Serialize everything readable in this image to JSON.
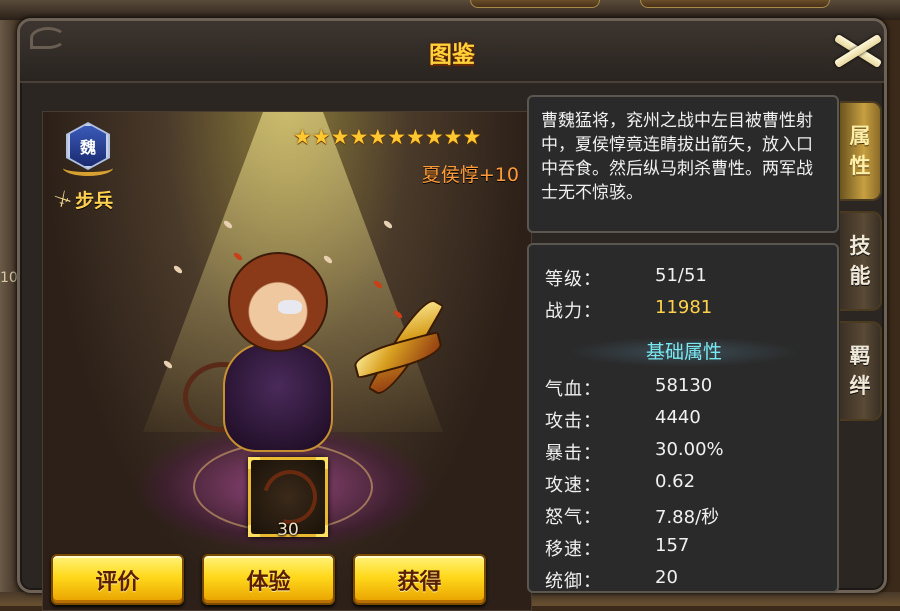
{
  "dialog": {
    "title": "图鉴"
  },
  "hero": {
    "faction": "魏",
    "unit_type": "步兵",
    "stars": 10,
    "name": "夏侯惇+10",
    "skill_level": "30"
  },
  "description": "曹魏猛将，兖州之战中左目被曹性射中，夏侯惇竟连睛拔出箭矢，放入口中吞食。然后纵马刺杀曹性。两军战士无不惊骇。",
  "stats": {
    "level_label": "等级：",
    "level_value": "51/51",
    "power_label": "战力：",
    "power_value": "11981",
    "section_title": "基础属性",
    "hp_label": "气血：",
    "hp_value": "58130",
    "atk_label": "攻击：",
    "atk_value": "4440",
    "crit_label": "暴击：",
    "crit_value": "30.00%",
    "atkspd_label": "攻速：",
    "atkspd_value": "0.62",
    "rage_label": "怒气：",
    "rage_value": "7.88/秒",
    "movespd_label": "移速：",
    "movespd_value": "157",
    "def_label": "统御：",
    "def_value": "20"
  },
  "buttons": {
    "rate": "评价",
    "try": "体验",
    "obtain": "获得"
  },
  "tabs": [
    {
      "label_1": "属",
      "label_2": "性",
      "active": true
    },
    {
      "label_1": "技",
      "label_2": "能",
      "active": false
    },
    {
      "label_1": "羁",
      "label_2": "绊",
      "active": false
    }
  ],
  "background": {
    "left_number": "10"
  },
  "colors": {
    "title": "#ffd23a",
    "hero_name": "#ff9a3a",
    "section_title": "#7ae8f0",
    "power_value": "#ffd24a",
    "button_face": "#ffd81a"
  }
}
